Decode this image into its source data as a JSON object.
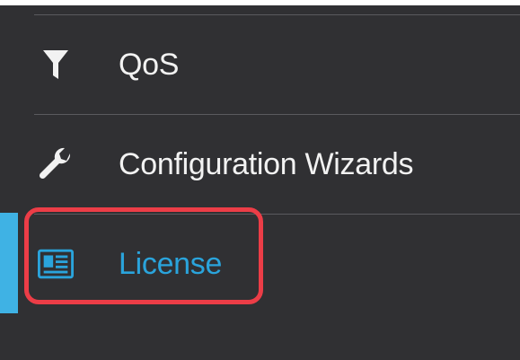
{
  "sidebar": {
    "items": [
      {
        "label": "QoS",
        "icon": "filter-icon",
        "active": false
      },
      {
        "label": "Configuration Wizards",
        "icon": "wrench-icon",
        "active": false
      },
      {
        "label": "License",
        "icon": "license-icon",
        "active": true
      }
    ]
  },
  "colors": {
    "background": "#303033",
    "text": "#f2f2f2",
    "active_text": "#2aa4dc",
    "active_indicator": "#3fb2e4",
    "highlight": "#ec3d47",
    "divider": "#5a5a5e"
  }
}
